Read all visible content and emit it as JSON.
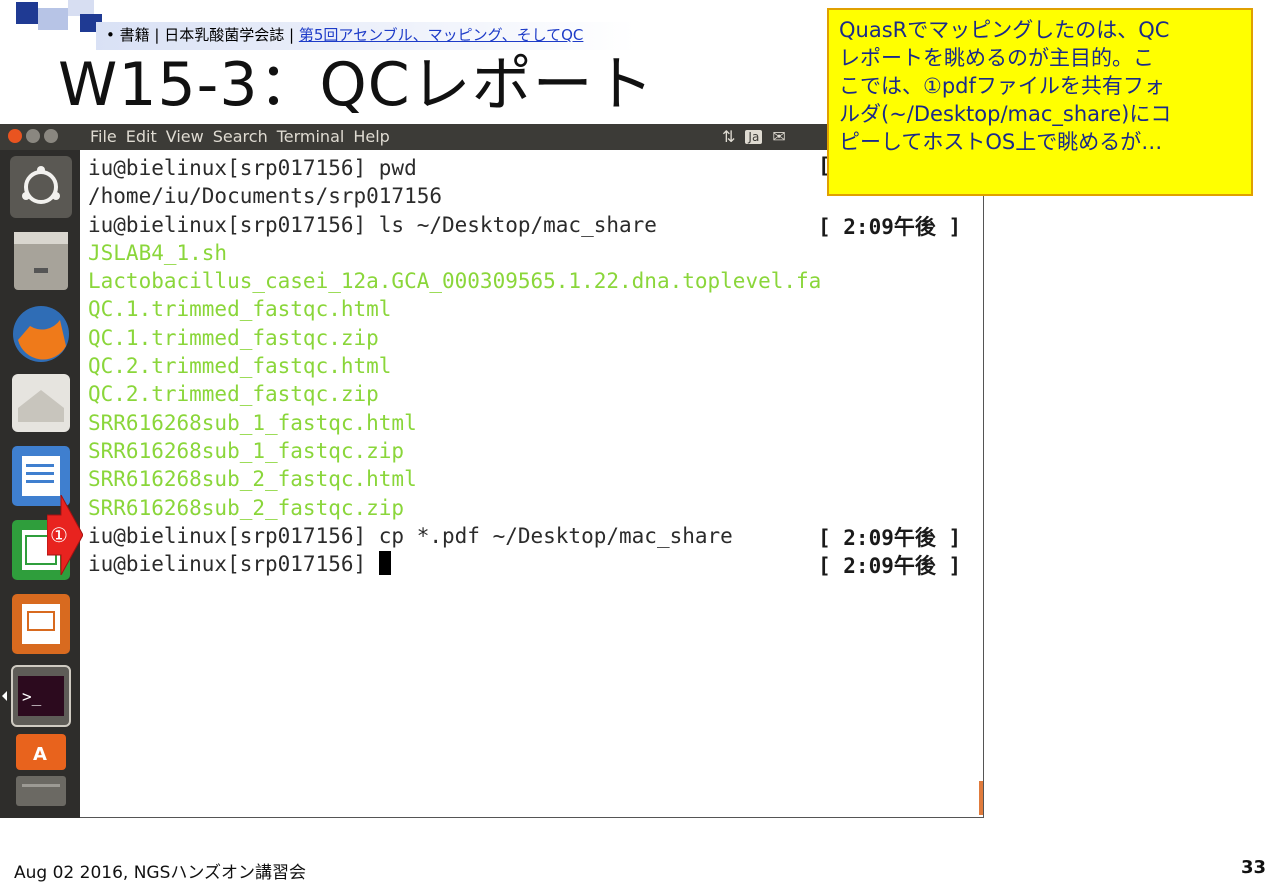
{
  "slide": {
    "breadcrumb_bullet": "•",
    "breadcrumb_text": "書籍 | 日本乳酸菌学会誌 | ",
    "breadcrumb_link": "第5回アセンブル、マッピング、そしてQC",
    "title": "W15-3：QCレポート",
    "callout_lines": [
      "QuasRでマッピングしたのは、QC",
      "レポートを眺めるのが主目的。こ",
      "こでは、①pdfファイルを共有フォ",
      "ルダ(~/Desktop/mac_share)にコ",
      "ピーしてホストOS上で眺めるが…"
    ],
    "footer": "Aug 02 2016, NGSハンズオン講習会",
    "page_number": "33",
    "step_marker": "①"
  },
  "menubar": {
    "items": [
      "File",
      "Edit",
      "View",
      "Search",
      "Terminal",
      "Help"
    ],
    "input_method": "Ja"
  },
  "launcher": {
    "icons": [
      "ubuntu-dash-icon",
      "files-icon",
      "firefox-icon",
      "mail-icon",
      "writer-icon",
      "calc-icon",
      "impress-icon",
      "terminal-icon",
      "software-center-icon",
      "trash-icon"
    ]
  },
  "terminal": {
    "lines": [
      {
        "text": "iu@bielinux[srp017156] pwd",
        "color": "default"
      },
      {
        "text": "/home/iu/Documents/srp017156",
        "color": "default"
      },
      {
        "text": "iu@bielinux[srp017156] ls ~/Desktop/mac_share",
        "color": "default"
      },
      {
        "text": "JSLAB4_1.sh",
        "color": "green"
      },
      {
        "text": "Lactobacillus_casei_12a.GCA_000309565.1.22.dna.toplevel.fa",
        "color": "green"
      },
      {
        "text": "QC.1.trimmed_fastqc.html",
        "color": "green"
      },
      {
        "text": "QC.1.trimmed_fastqc.zip",
        "color": "green"
      },
      {
        "text": "QC.2.trimmed_fastqc.html",
        "color": "green"
      },
      {
        "text": "QC.2.trimmed_fastqc.zip",
        "color": "green"
      },
      {
        "text": "SRR616268sub_1_fastqc.html",
        "color": "green"
      },
      {
        "text": "SRR616268sub_1_fastqc.zip",
        "color": "green"
      },
      {
        "text": "SRR616268sub_2_fastqc.html",
        "color": "green"
      },
      {
        "text": "SRR616268sub_2_fastqc.zip",
        "color": "green"
      },
      {
        "text": "iu@bielinux[srp017156] cp *.pdf ~/Desktop/mac_share",
        "color": "default"
      },
      {
        "text": "iu@bielinux[srp017156] ",
        "color": "default"
      }
    ],
    "timestamps": [
      {
        "line": 0,
        "text": "["
      },
      {
        "line": 2,
        "text": "[ 2:09午後 ]"
      },
      {
        "line": 13,
        "text": "[ 2:09午後 ]"
      },
      {
        "line": 14,
        "text": "[ 2:09午後 ]"
      }
    ]
  },
  "colors": {
    "terminal_green": "#8ad63a",
    "callout_bg": "#ffff00",
    "callout_text": "#1a2a8a",
    "arrow": "#e8231f"
  }
}
